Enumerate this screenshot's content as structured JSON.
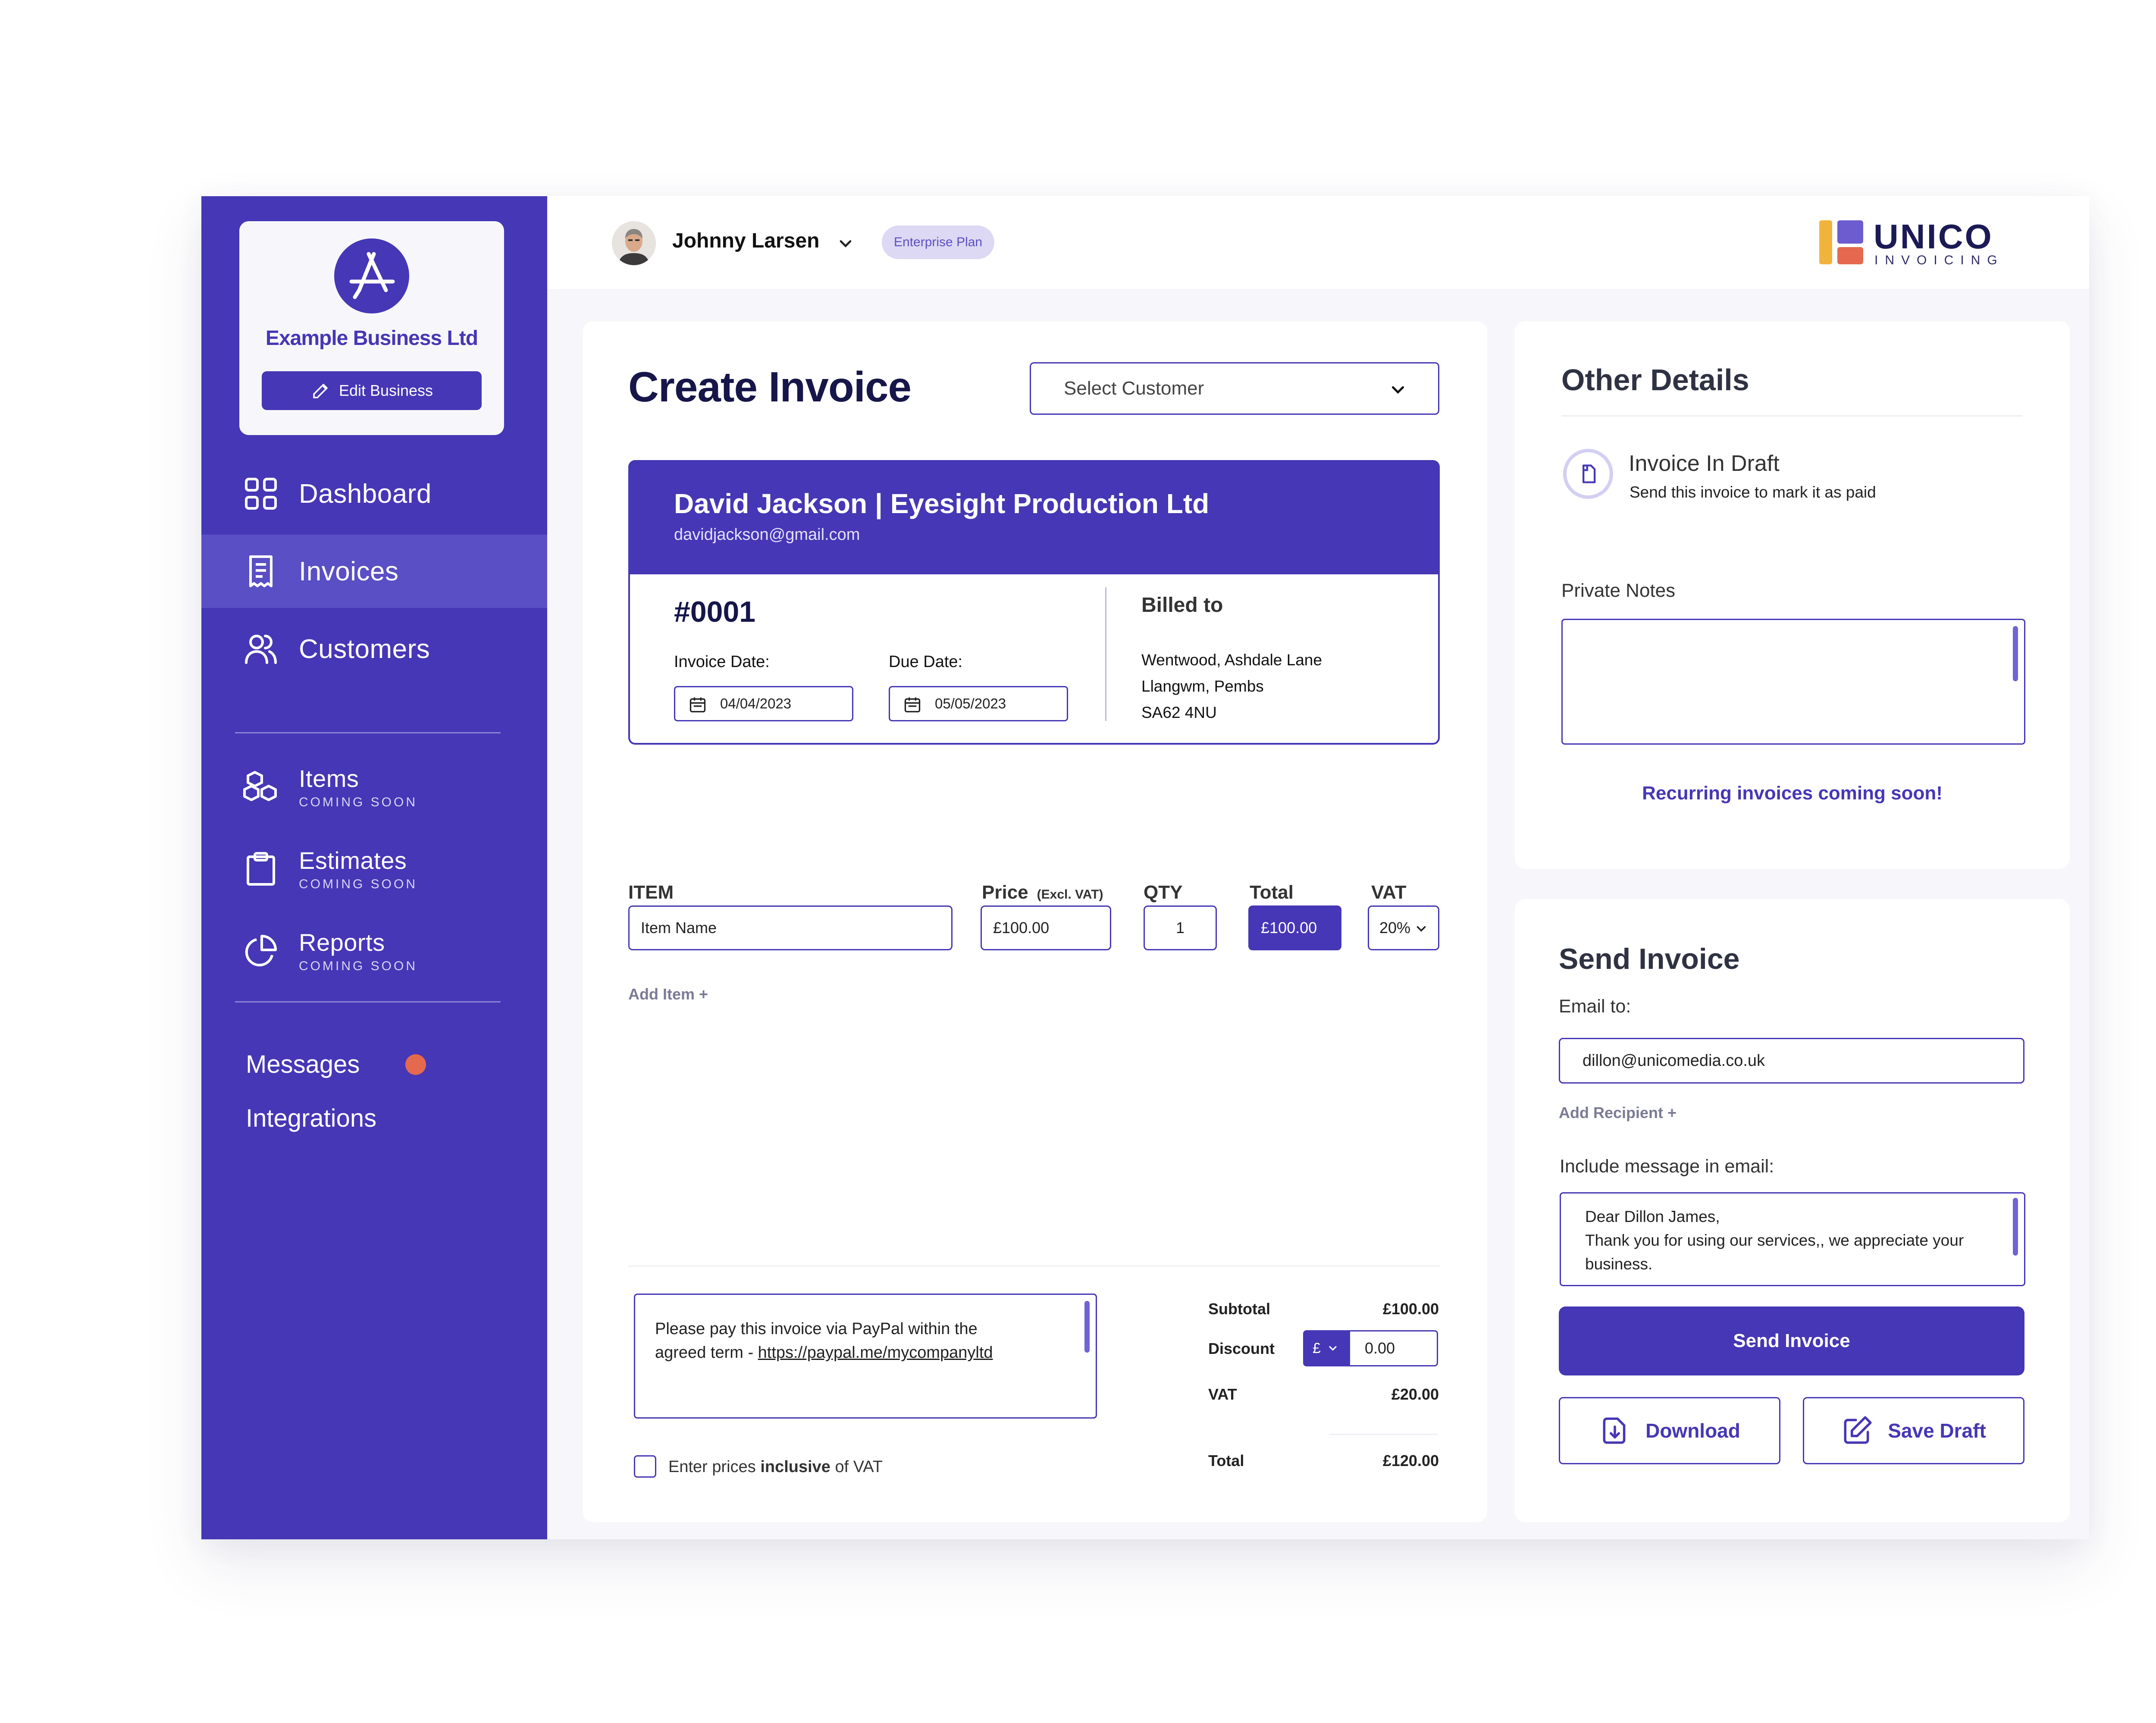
{
  "sidebar": {
    "business_name": "Example Business Ltd",
    "edit_label": "Edit Business",
    "nav": [
      {
        "label": "Dashboard",
        "icon": "grid-icon"
      },
      {
        "label": "Invoices",
        "icon": "receipt-icon",
        "active": true
      },
      {
        "label": "Customers",
        "icon": "users-icon"
      }
    ],
    "soon_nav": [
      {
        "label": "Items",
        "sub": "COMING SOON",
        "icon": "boxes-icon"
      },
      {
        "label": "Estimates",
        "sub": "COMING SOON",
        "icon": "clipboard-icon"
      },
      {
        "label": "Reports",
        "sub": "COMING SOON",
        "icon": "pie-chart-icon"
      }
    ],
    "messages_label": "Messages",
    "integrations_label": "Integrations"
  },
  "topbar": {
    "user_name": "Johnny Larsen",
    "plan": "Enterprise Plan",
    "brand_name": "UNICO",
    "brand_sub": "INVOICING"
  },
  "invoice": {
    "title": "Create Invoice",
    "select_customer": "Select Customer",
    "customer_name": "David Jackson | Eyesight Production Ltd",
    "customer_email": "davidjackson@gmail.com",
    "number": "#0001",
    "invoice_date_label": "Invoice Date:",
    "invoice_date": "04/04/2023",
    "due_date_label": "Due Date:",
    "due_date": "05/05/2023",
    "billed_to_label": "Billed to",
    "address": [
      "Wentwood, Ashdale Lane",
      "Llangwm, Pembs",
      "SA62 4NU"
    ],
    "columns": {
      "item": "ITEM",
      "price": "Price",
      "price_note": "(Excl. VAT)",
      "qty": "QTY",
      "total": "Total",
      "vat": "VAT"
    },
    "line": {
      "item": "Item Name",
      "price": "£100.00",
      "qty": "1",
      "total": "£100.00",
      "vat": "20%"
    },
    "add_item": "Add Item +",
    "terms_line1": "Please pay this invoice via PayPal within the",
    "terms_line2_prefix": "agreed term - ",
    "terms_link": "https://paypal.me/mycompanyltd",
    "inclusive_prefix": "Enter prices ",
    "inclusive_bold": "inclusive",
    "inclusive_suffix": " of VAT",
    "subtotal_label": "Subtotal",
    "subtotal": "£100.00",
    "discount_label": "Discount",
    "discount_currency": "£",
    "discount": "0.00",
    "vat_label": "VAT",
    "vat": "£20.00",
    "total_label": "Total",
    "total": "£120.00"
  },
  "other": {
    "title": "Other Details",
    "draft_title": "Invoice In Draft",
    "draft_sub": "Send this invoice to mark it as paid",
    "notes_label": "Private Notes",
    "recurring": "Recurring invoices coming soon!"
  },
  "send": {
    "title": "Send Invoice",
    "email_label": "Email to:",
    "email": "dillon@unicomedia.co.uk",
    "add_recipient": "Add Recipient +",
    "message_label": "Include message in email:",
    "message_lines": [
      "Dear Dillon James,",
      "Thank you for using our services,, we appreciate your",
      "business."
    ],
    "send_label": "Send Invoice",
    "download_label": "Download",
    "save_label": "Save Draft"
  },
  "colors": {
    "primary": "#4537b5",
    "active_nav": "#5a4fc4",
    "notify": "#e4694f",
    "brand_yellow": "#f2b33d",
    "brand_purple": "#6c5ccf",
    "brand_red": "#e4694f"
  }
}
